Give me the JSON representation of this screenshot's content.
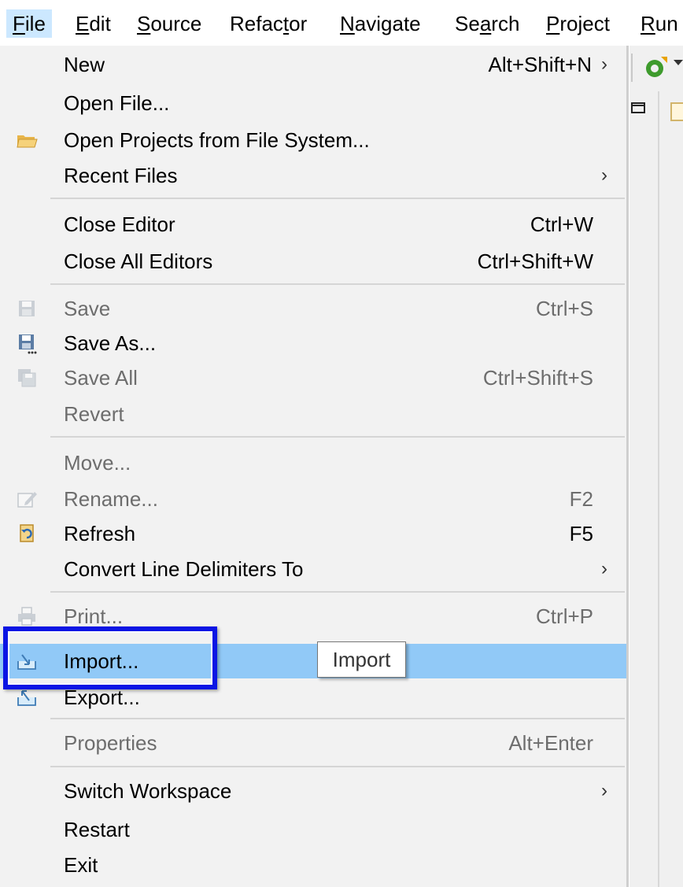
{
  "menubar": {
    "items": [
      {
        "pre": "",
        "mnem": "F",
        "post": "ile"
      },
      {
        "pre": "",
        "mnem": "E",
        "post": "dit"
      },
      {
        "pre": "",
        "mnem": "S",
        "post": "ource"
      },
      {
        "pre": "Refac",
        "mnem": "t",
        "post": "or"
      },
      {
        "pre": "",
        "mnem": "N",
        "post": "avigate"
      },
      {
        "pre": "Se",
        "mnem": "a",
        "post": "rch"
      },
      {
        "pre": "",
        "mnem": "P",
        "post": "roject"
      },
      {
        "pre": "",
        "mnem": "R",
        "post": "un"
      }
    ]
  },
  "menu": {
    "items": [
      {
        "label": "New",
        "accel": "Alt+Shift+N",
        "submenu": "›"
      },
      {
        "label": "Open File..."
      },
      {
        "label": "Open Projects from File System...",
        "icon": "folder-open-icon"
      },
      {
        "label": "Recent Files",
        "submenu": "›"
      },
      {
        "label": "Close Editor",
        "accel": "Ctrl+W"
      },
      {
        "label": "Close All Editors",
        "accel": "Ctrl+Shift+W"
      },
      {
        "label": "Save",
        "accel": "Ctrl+S",
        "icon": "save-icon",
        "disabled": true
      },
      {
        "label": "Save As...",
        "icon": "save-as-icon"
      },
      {
        "label": "Save All",
        "accel": "Ctrl+Shift+S",
        "icon": "save-all-icon",
        "disabled": true
      },
      {
        "label": "Revert",
        "disabled": true
      },
      {
        "label": "Move...",
        "disabled": true
      },
      {
        "label": "Rename...",
        "accel": "F2",
        "icon": "rename-icon",
        "disabled": true
      },
      {
        "label": "Refresh",
        "accel": "F5",
        "icon": "refresh-icon"
      },
      {
        "label": "Convert Line Delimiters To",
        "submenu": "›"
      },
      {
        "label": "Print...",
        "accel": "Ctrl+P",
        "icon": "print-icon",
        "disabled": true
      },
      {
        "label": "Import...",
        "icon": "import-icon",
        "highlighted": true
      },
      {
        "label": "Export...",
        "icon": "export-icon"
      },
      {
        "label": "Properties",
        "accel": "Alt+Enter",
        "disabled": true
      },
      {
        "label": "Switch Workspace",
        "submenu": "›"
      },
      {
        "label": "Restart"
      },
      {
        "label": "Exit"
      }
    ]
  },
  "tooltip": {
    "text": "Import"
  },
  "colors": {
    "highlight": "#91c9f7",
    "annotation": "#0b15e4",
    "menu_bg": "#f2f2f2"
  }
}
